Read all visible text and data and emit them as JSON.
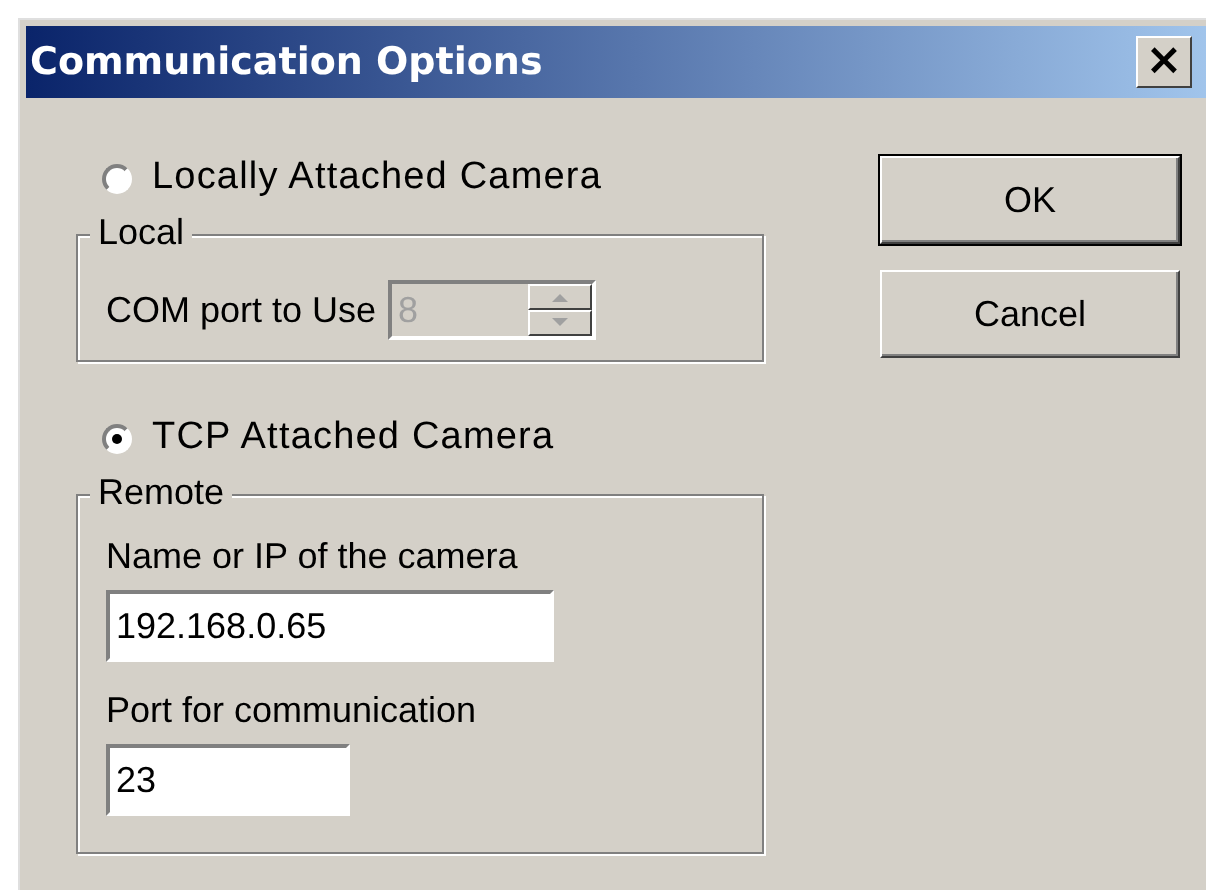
{
  "window": {
    "title": "Communication Options",
    "close": "×"
  },
  "options": [
    {
      "label": "Locally Attached Camera",
      "selected": false,
      "group": {
        "title": "Local",
        "fields": [
          {
            "kind": "spinner",
            "label": "COM port to Use",
            "value": "8",
            "disabled": true
          }
        ]
      }
    },
    {
      "label": "TCP Attached Camera",
      "selected": true,
      "group": {
        "title": "Remote",
        "fields": [
          {
            "kind": "text",
            "label": "Name or IP of the camera",
            "value": "192.168.0.65",
            "disabled": false
          },
          {
            "kind": "text",
            "label": "Port for communication",
            "value": "23",
            "disabled": false
          }
        ]
      }
    }
  ],
  "buttons": [
    "OK",
    "Cancel"
  ]
}
